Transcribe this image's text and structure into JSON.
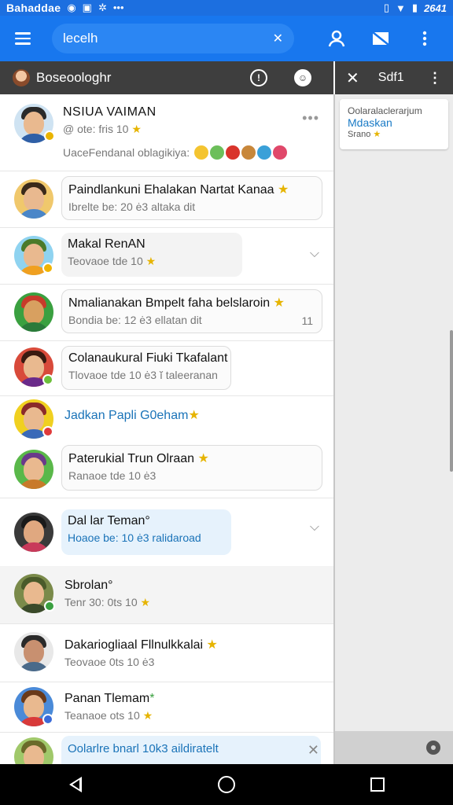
{
  "status_bar": {
    "carrier": "Bahaddae",
    "time": "2641"
  },
  "app_bar": {
    "search_text": "lecelh",
    "icons": [
      "menu-icon",
      "clear-icon",
      "person-icon",
      "compose-icon",
      "overflow-icon"
    ]
  },
  "panel": {
    "title": "Boseoologhr"
  },
  "side_panel": {
    "title": "Sdf1",
    "card": {
      "line1": "Oolaralaclerarjum",
      "line2": "Mdaskan",
      "line3": "Srano"
    }
  },
  "chats": [
    {
      "name": "NSIUA VAIMAN",
      "sub": "@ ote: fris 10",
      "preview": "UaceFendanal oblagikiya:"
    },
    {
      "name": "Paindlankuni Ehalakan Nartat Kanaa",
      "sub": "Ibrelte be: 20 ė3 altaka dit"
    },
    {
      "name": "Makal RenAN",
      "sub": "Teovaoe tde 10"
    },
    {
      "name": "Nmalianakan Bmpelt faha belslaroin",
      "sub": "Bondia be: 12 ė3 ellatan dit",
      "meta": "11"
    },
    {
      "name": "Colanaukural Fiuki Tkafalant",
      "sub": "Tlovaoe tde 10 ė3 ĭ taleeranan"
    },
    {
      "name": "Jadkan Papli G0eham"
    },
    {
      "name": "Paterukial Trun Olraan",
      "sub": "Ranaoe tde 10 ė3"
    },
    {
      "name": "Dal lar Teman°",
      "sub": "Hoaoe be: 10 ė3 ralidaroad"
    },
    {
      "name": "Sbrolan°",
      "sub": "Tenr 30: 0ts 10"
    },
    {
      "name": "Dakariogliaal Fllnulkkalai",
      "sub": "Teovaoe 0ts 10 ė3"
    },
    {
      "name": "Panan Tlemam",
      "sub": "Teanaoe ots 10"
    },
    {
      "name": "Oolarlre bnarl 10k3 aildiratelt"
    }
  ]
}
